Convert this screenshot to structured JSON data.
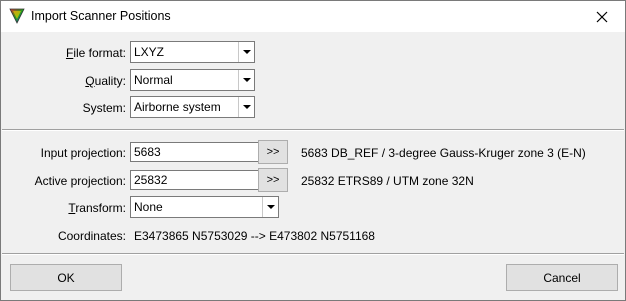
{
  "window": {
    "title": "Import Scanner Positions",
    "icon": "app-triangle-icon",
    "close": "close-icon"
  },
  "format_section": {
    "file_format": {
      "label_prefix": "",
      "mnemonic": "F",
      "label_rest": "ile format:",
      "value": "LXYZ"
    },
    "quality": {
      "label_prefix": "",
      "mnemonic": "Q",
      "label_rest": "uality:",
      "value": "Normal"
    },
    "system": {
      "label": "System:",
      "value": "Airborne system"
    }
  },
  "projection_section": {
    "input_projection": {
      "label": "Input projection:",
      "value": "5683",
      "button": ">>",
      "description": "5683 DB_REF / 3-degree Gauss-Kruger zone 3 (E-N)"
    },
    "active_projection": {
      "label": "Active projection:",
      "value": "25832",
      "button": ">>",
      "description": "25832 ETRS89 / UTM zone 32N"
    },
    "transform": {
      "mnemonic": "T",
      "label_rest": "ransform:",
      "value": "None"
    },
    "coordinates": {
      "label": "Coordinates:",
      "value": "E3473865 N5753029 --> E473802 N5751168"
    }
  },
  "footer": {
    "ok": "OK",
    "cancel": "Cancel"
  },
  "colors": {
    "dialog_bg": "#f0f0f0",
    "title_bg": "#ffffff",
    "button_bg": "#e1e1e1",
    "field_border": "#7a7a7a"
  }
}
